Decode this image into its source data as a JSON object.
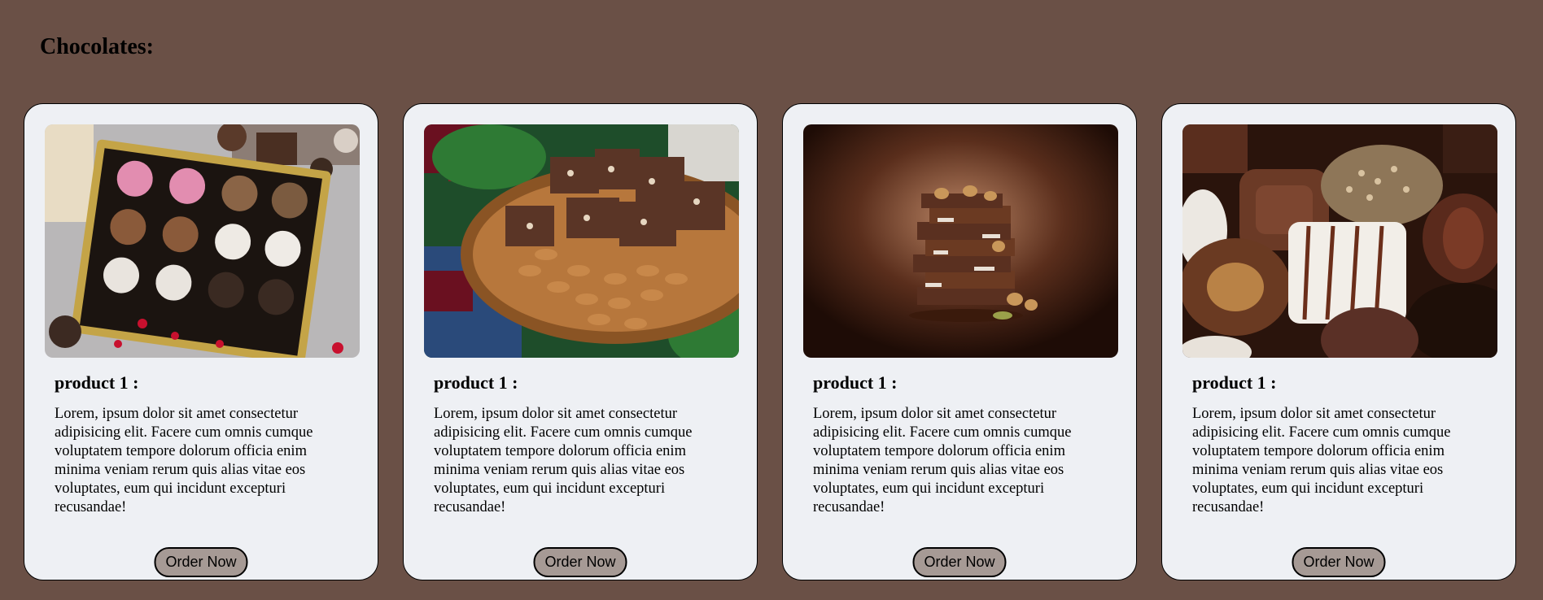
{
  "page": {
    "title": "Chocolates:"
  },
  "products": [
    {
      "title": "product 1 :",
      "description": "Lorem, ipsum dolor sit amet consectetur adipisicing elit. Facere cum omnis cumque voluptatem tempore dolorum officia enim minima veniam rerum quis alias vitae eos voluptates, eum qui incidunt excepturi recusandae!",
      "button_label": "Order Now"
    },
    {
      "title": "product 1 :",
      "description": "Lorem, ipsum dolor sit amet consectetur adipisicing elit. Facere cum omnis cumque voluptatem tempore dolorum officia enim minima veniam rerum quis alias vitae eos voluptates, eum qui incidunt excepturi recusandae!",
      "button_label": "Order Now"
    },
    {
      "title": "product 1 :",
      "description": "Lorem, ipsum dolor sit amet consectetur adipisicing elit. Facere cum omnis cumque voluptatem tempore dolorum officia enim minima veniam rerum quis alias vitae eos voluptates, eum qui incidunt excepturi recusandae!",
      "button_label": "Order Now"
    },
    {
      "title": "product 1 :",
      "description": "Lorem, ipsum dolor sit amet consectetur adipisicing elit. Facere cum omnis cumque voluptatem tempore dolorum officia enim minima veniam rerum quis alias vitae eos voluptates, eum qui incidunt excepturi recusandae!",
      "button_label": "Order Now"
    }
  ],
  "colors": {
    "background": "#6a5046",
    "card": "#eef0f4",
    "button": "#a69a95"
  }
}
